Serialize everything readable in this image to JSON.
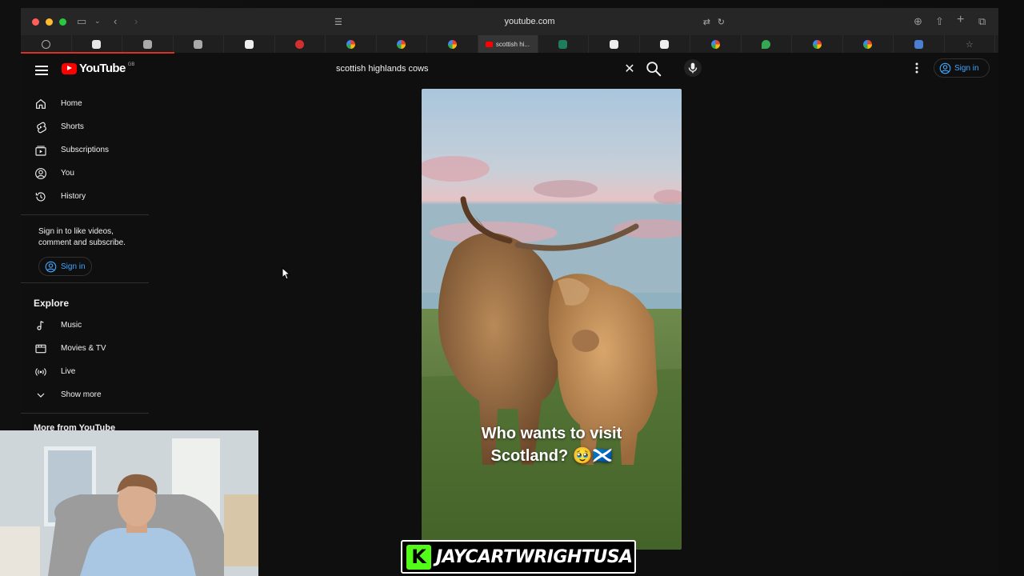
{
  "browser": {
    "url": "youtube.com",
    "active_tab_label": "scottish hi...",
    "tab_count": 19
  },
  "youtube": {
    "logo_text": "YouTube",
    "country_code": "GB",
    "search": {
      "value": "scottish highlands cows"
    },
    "top_signin_label": "Sign in",
    "sidebar": {
      "main": [
        {
          "label": "Home",
          "icon": "home-icon"
        },
        {
          "label": "Shorts",
          "icon": "shorts-icon"
        },
        {
          "label": "Subscriptions",
          "icon": "subscriptions-icon"
        },
        {
          "label": "You",
          "icon": "you-icon"
        },
        {
          "label": "History",
          "icon": "history-icon"
        }
      ],
      "signin_note": "Sign in to like videos, comment and subscribe.",
      "signin_label": "Sign in",
      "explore_title": "Explore",
      "explore": [
        {
          "label": "Music",
          "icon": "music-icon"
        },
        {
          "label": "Movies & TV",
          "icon": "movies-icon"
        },
        {
          "label": "Live",
          "icon": "live-icon"
        },
        {
          "label": "Show more",
          "icon": "chevron-down-icon"
        }
      ],
      "more_title": "More from YouTube"
    },
    "video": {
      "caption_line1": "Who wants to visit",
      "caption_line2": "Scotland? 🥹🏴󠁧󠁢󠁳󠁣󠁴󠁿"
    }
  },
  "overlay": {
    "watermark_letter": "K",
    "watermark_name": "JAYCARTWRIGHTUSA"
  },
  "colors": {
    "youtube_red": "#ff0000",
    "link_blue": "#3ea6ff",
    "kick_green": "#53fc18",
    "background": "#0f0f0f"
  }
}
